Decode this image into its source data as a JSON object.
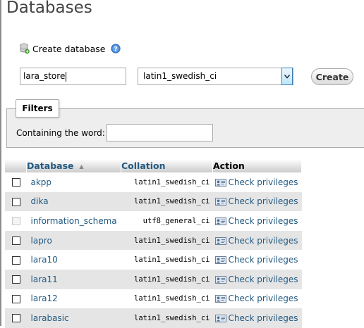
{
  "page": {
    "title": "Databases"
  },
  "create_database": {
    "label": "Create database",
    "name_value": "lara_store",
    "collation_value": "latin1_swedish_ci",
    "create_button_label": "Create"
  },
  "filters": {
    "legend": "Filters",
    "containing_label": "Containing the word:",
    "containing_value": ""
  },
  "table": {
    "headers": {
      "database": "Database",
      "collation": "Collation",
      "action": "Action"
    },
    "rows": [
      {
        "name": "akpp",
        "collation": "latin1_swedish_ci",
        "action": "Check privileges",
        "checkbox_enabled": true
      },
      {
        "name": "dika",
        "collation": "latin1_swedish_ci",
        "action": "Check privileges",
        "checkbox_enabled": true
      },
      {
        "name": "information_schema",
        "collation": "utf8_general_ci",
        "action": "Check privileges",
        "checkbox_enabled": false
      },
      {
        "name": "lapro",
        "collation": "latin1_swedish_ci",
        "action": "Check privileges",
        "checkbox_enabled": true
      },
      {
        "name": "lara10",
        "collation": "latin1_swedish_ci",
        "action": "Check privileges",
        "checkbox_enabled": true
      },
      {
        "name": "lara11",
        "collation": "latin1_swedish_ci",
        "action": "Check privileges",
        "checkbox_enabled": true
      },
      {
        "name": "lara12",
        "collation": "latin1_swedish_ci",
        "action": "Check privileges",
        "checkbox_enabled": true
      },
      {
        "name": "larabasic",
        "collation": "latin1_swedish_ci",
        "action": "Check privileges",
        "checkbox_enabled": true
      }
    ]
  },
  "icons": {
    "create": "database-plus-icon",
    "help": "help-icon",
    "dropdown": "chevron-down-icon",
    "sort": "sort-ascending-icon",
    "privileges": "check-privileges-icon"
  },
  "colors": {
    "link": "#235a81",
    "row_alt": "#e5e5e5",
    "filter_bg": "#eeeeee",
    "help_blue": "#3b7fd4"
  }
}
